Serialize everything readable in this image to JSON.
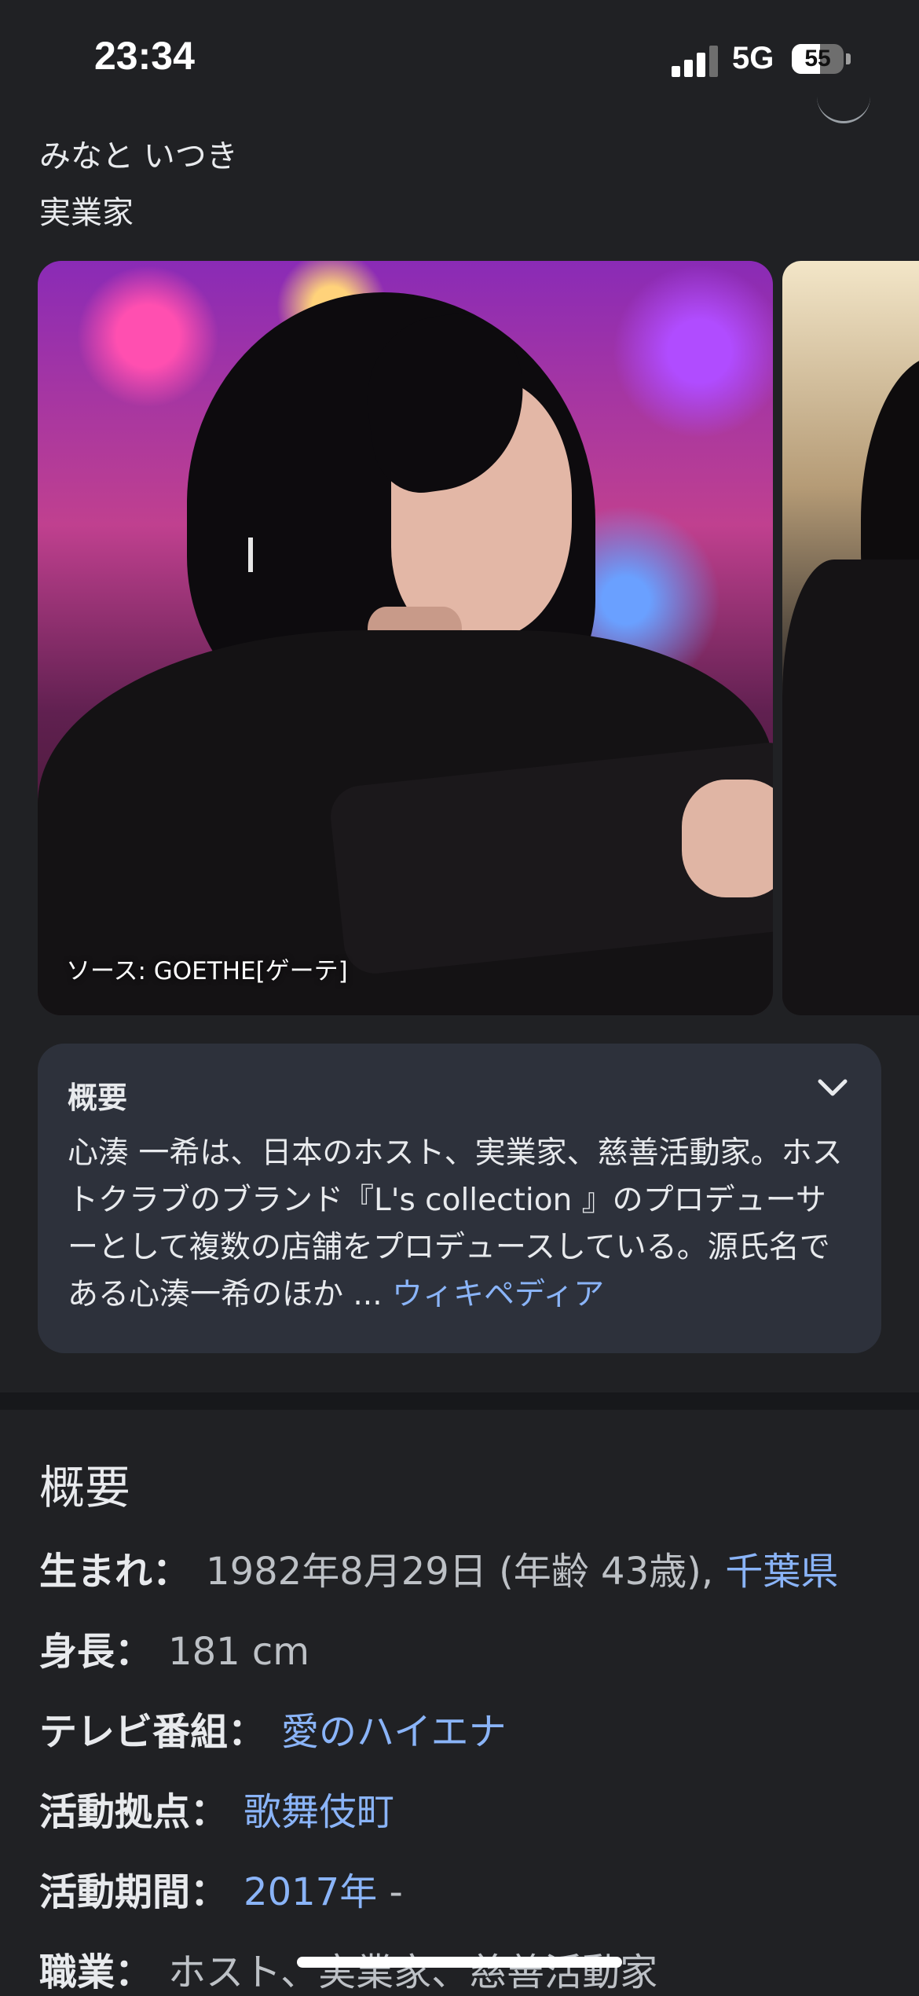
{
  "status_bar": {
    "time": "23:34",
    "network": "5G",
    "battery_level": "55",
    "battery_fraction": 0.55
  },
  "header": {
    "reading": "みなと いつき",
    "subtitle": "実業家"
  },
  "images": {
    "caption": "ソース: GOETHE[ゲーテ]"
  },
  "summary_card": {
    "title": "概要",
    "text": "心湊 一希は、日本のホスト、実業家、慈善活動家。ホストクラブのブランド『L's collection 』のプロデューサーとして複数の店舗をプロデュースしている。源氏名である心湊一希のほか",
    "ellipsis": " ... ",
    "source_link": "ウィキペディア"
  },
  "facts": {
    "heading": "概要",
    "separator": "：",
    "items": [
      {
        "label": "生まれ",
        "value": "1982年8月29日 (年齢 43歳), ",
        "link": "千葉県"
      },
      {
        "label": "身長",
        "value": "181 cm",
        "link": ""
      },
      {
        "label": "テレビ番組",
        "value": "",
        "link": "愛のハイエナ"
      },
      {
        "label": "活動拠点",
        "value": "",
        "link": "歌舞伎町"
      },
      {
        "label": "活動期間",
        "value": "",
        "link": "2017年",
        "suffix": " -"
      },
      {
        "label": "職業",
        "value": "ホスト、実業家、慈善活動家",
        "link": ""
      }
    ]
  },
  "colors": {
    "background": "#202124",
    "card": "#2d313b",
    "link": "#8ab4f8"
  }
}
